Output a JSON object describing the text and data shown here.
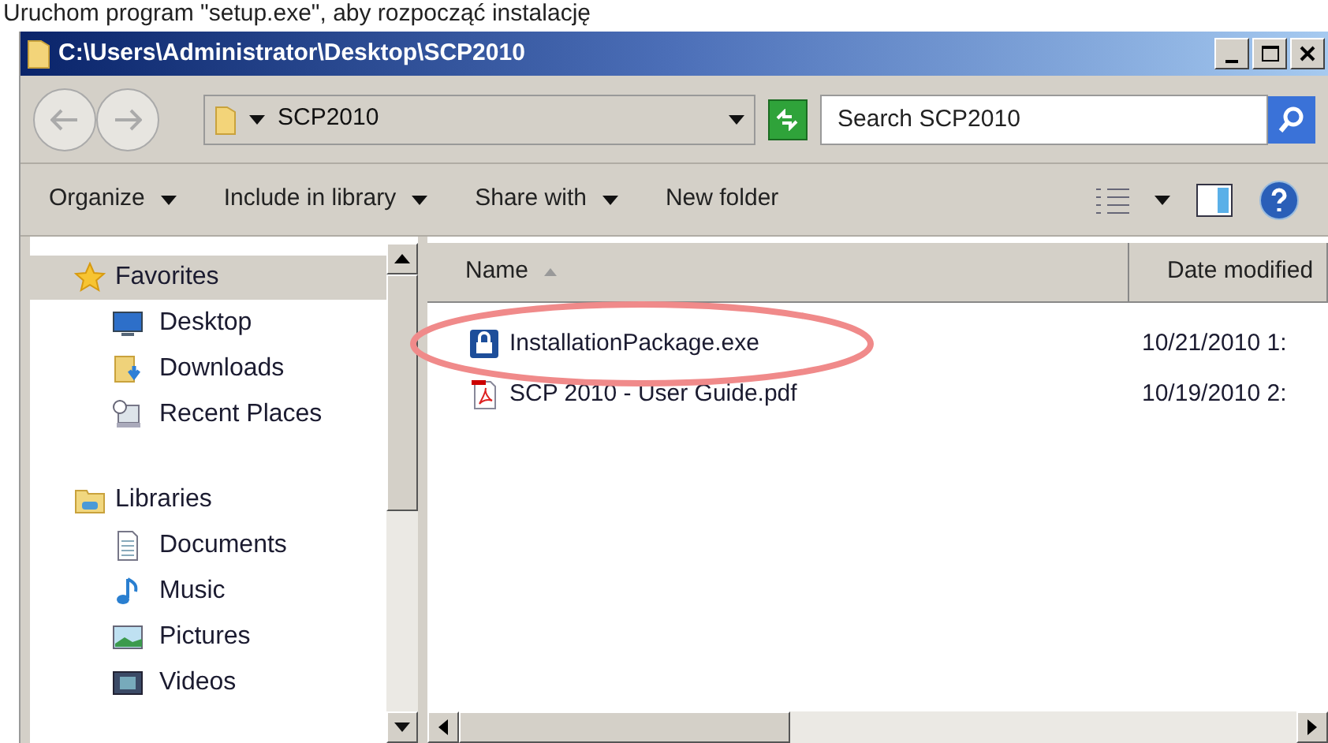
{
  "caption": "Uruchom program \"setup.exe\", aby rozpocząć instalację",
  "window": {
    "title": "C:\\Users\\Administrator\\Desktop\\SCP2010"
  },
  "address_bar": {
    "path": "SCP2010",
    "search_placeholder": "Search SCP2010"
  },
  "toolbar": {
    "items": [
      {
        "label": "Organize",
        "dropdown": true
      },
      {
        "label": "Include in library",
        "dropdown": true
      },
      {
        "label": "Share with",
        "dropdown": true
      },
      {
        "label": "New folder",
        "dropdown": false
      }
    ]
  },
  "sidebar": {
    "groups": [
      {
        "label": "Favorites",
        "kind": "star",
        "selected": true,
        "children": [
          {
            "label": "Desktop",
            "kind": "desktop"
          },
          {
            "label": "Downloads",
            "kind": "downloads"
          },
          {
            "label": "Recent Places",
            "kind": "recent"
          }
        ]
      },
      {
        "label": "Libraries",
        "kind": "libraries",
        "selected": false,
        "children": [
          {
            "label": "Documents",
            "kind": "documents"
          },
          {
            "label": "Music",
            "kind": "music"
          },
          {
            "label": "Pictures",
            "kind": "pictures"
          },
          {
            "label": "Videos",
            "kind": "videos"
          }
        ]
      }
    ]
  },
  "file_list": {
    "columns": [
      {
        "label": "Name",
        "sorted": true
      },
      {
        "label": "Date modified",
        "sorted": false
      }
    ],
    "rows": [
      {
        "name": "InstallationPackage.exe",
        "date": "10/21/2010 1:",
        "kind": "exe",
        "circled": true
      },
      {
        "name": "SCP 2010 - User Guide.pdf",
        "date": "10/19/2010 2:",
        "kind": "pdf",
        "circled": false
      }
    ]
  }
}
